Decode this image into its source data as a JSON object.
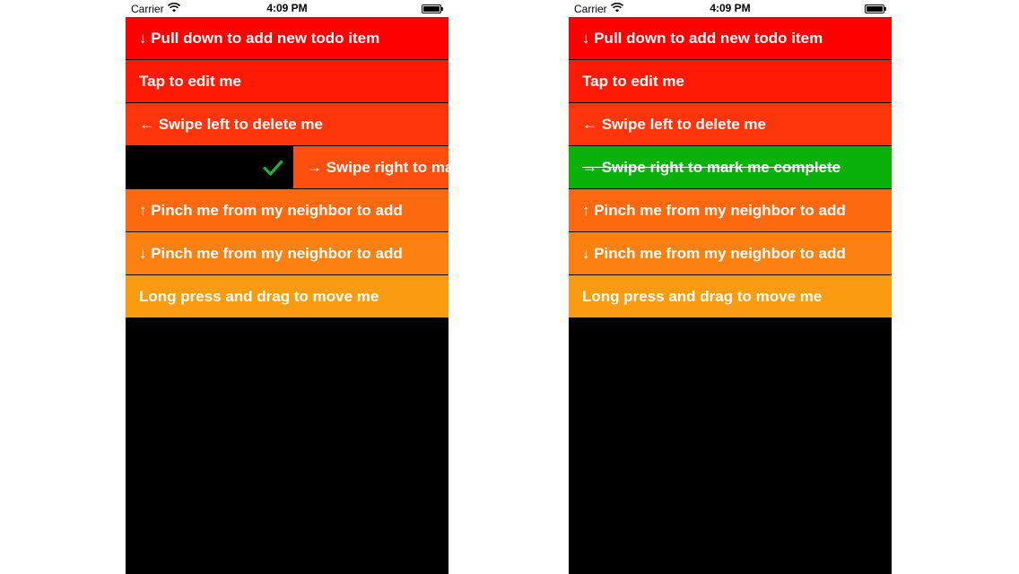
{
  "status_bar": {
    "carrier": "Carrier",
    "time": "4:09 PM",
    "wifi_icon": "wifi-icon",
    "battery_icon": "battery-icon"
  },
  "left_screen": {
    "rows": [
      {
        "label": "↓ Pull down to add new todo item",
        "color": "#ff0000"
      },
      {
        "label": "Tap to edit me",
        "color": "#ff1a05"
      },
      {
        "label": "← Swipe left to delete me",
        "color": "#ff350c"
      },
      {
        "label": "→ Swipe right to mark me complete",
        "color": "#fe4f0e",
        "swipe_action_icon": "checkmark-icon",
        "swipe_action_color": "#15b53a",
        "swipe_background": "#000000"
      },
      {
        "label": "↑ Pinch me from my neighbor to add",
        "color": "#fd690f"
      },
      {
        "label": "↓ Pinch me from my neighbor to add",
        "color": "#fc8110"
      },
      {
        "label": "Long press and drag to move me",
        "color": "#fb9b0f"
      }
    ]
  },
  "right_screen": {
    "rows": [
      {
        "label": "↓ Pull down to add new todo item",
        "color": "#ff0000"
      },
      {
        "label": "Tap to edit me",
        "color": "#ff1a05"
      },
      {
        "label": "← Swipe left to delete me",
        "color": "#ff350c"
      },
      {
        "label": "→ Swipe right to mark me complete",
        "color": "#09b10a",
        "completed": true
      },
      {
        "label": "↑ Pinch me from my neighbor to add",
        "color": "#fd690f"
      },
      {
        "label": "↓ Pinch me from my neighbor to add",
        "color": "#fc8110"
      },
      {
        "label": "Long press and drag to move me",
        "color": "#fb9b0f"
      }
    ]
  }
}
